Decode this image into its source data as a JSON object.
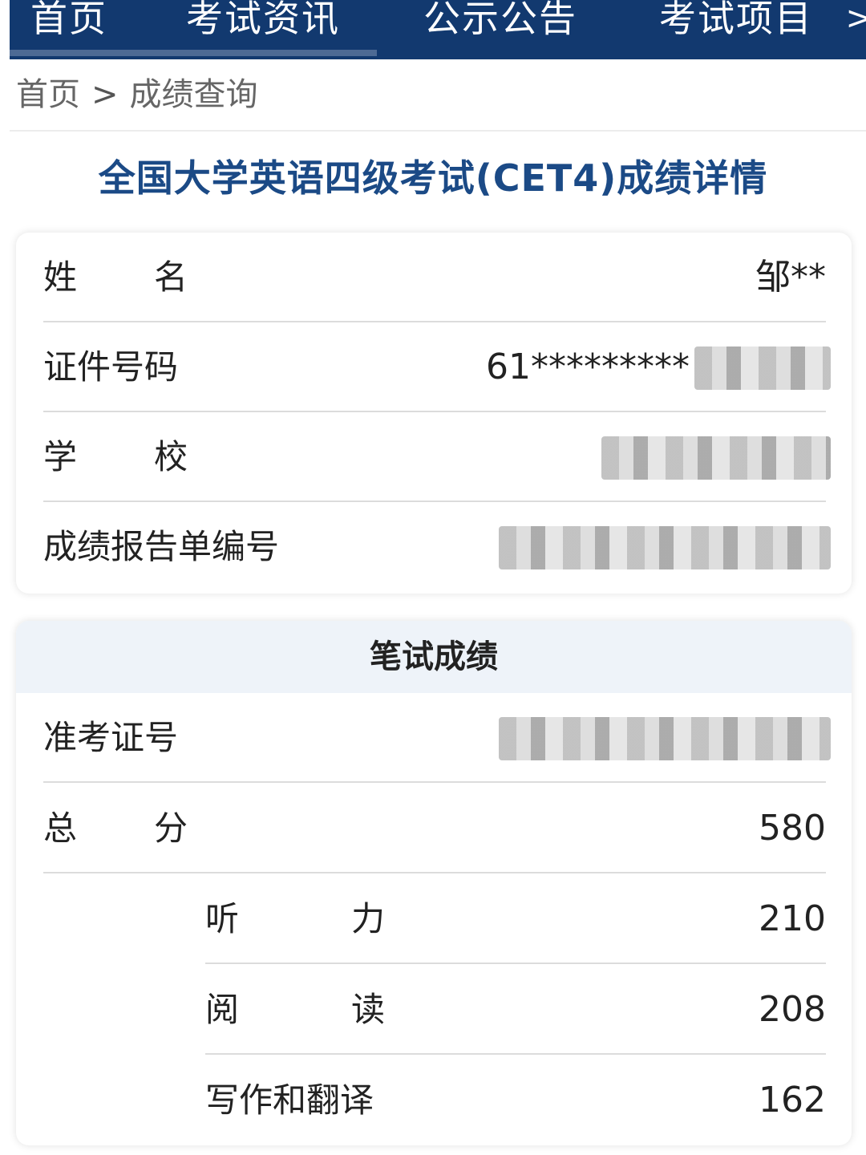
{
  "nav": {
    "items": [
      "首页",
      "考试资讯",
      "公示公告",
      "考试项目"
    ],
    "more": ">"
  },
  "breadcrumb": {
    "home": "首页",
    "separator": ">",
    "current": "成绩查询"
  },
  "page_title": "全国大学英语四级考试(CET4)成绩详情",
  "info": {
    "name_label": "姓名",
    "name_value": "邹**",
    "id_label": "证件号码",
    "id_value": "61*********",
    "school_label": "学校",
    "report_label": "成绩报告单编号"
  },
  "score": {
    "header": "笔试成绩",
    "ticket_label": "准考证号",
    "total_label": "总分",
    "total_value": "580",
    "listening_label": "听力",
    "listening_value": "210",
    "reading_label": "阅读",
    "reading_value": "208",
    "writing_label": "写作和翻译",
    "writing_value": "162"
  },
  "colors": {
    "nav_bg": "#12396f",
    "title": "#1b4a86",
    "total_score": "#c4282a",
    "sub_score": "#1b4a86"
  }
}
